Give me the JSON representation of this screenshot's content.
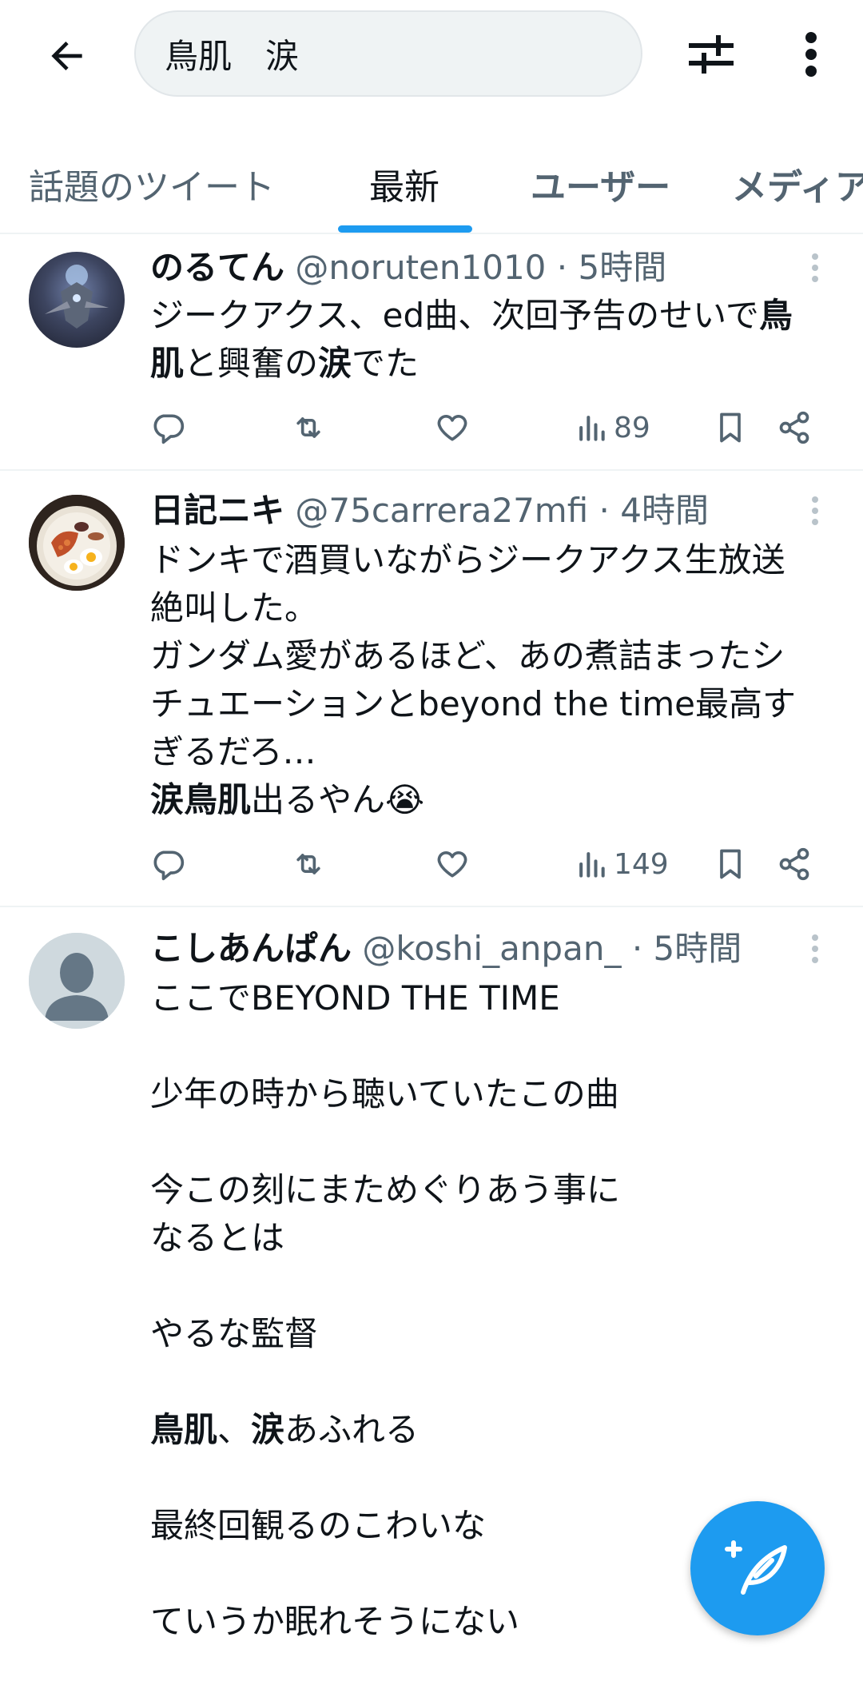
{
  "header": {
    "search_value": "鳥肌　涙",
    "back_icon": "arrow-left-icon",
    "filter_icon": "sliders-icon",
    "more_icon": "more-vertical-icon"
  },
  "tabs": [
    {
      "label": "話題のツイート"
    },
    {
      "label": "最新"
    },
    {
      "label": "ユーザー"
    },
    {
      "label": "メディア"
    }
  ],
  "tweets": [
    {
      "name": "のるてん",
      "handle": "@noruten1010",
      "sep": "·",
      "time": "5時間",
      "body": [
        [
          {
            "t": "ジークアクス、ed曲、次回予告のせいで"
          },
          {
            "t": "鳥",
            "b": true
          }
        ],
        [
          {
            "t": "肌",
            "b": true
          },
          {
            "t": "と興奮の"
          },
          {
            "t": "涙",
            "b": true
          },
          {
            "t": "でた"
          }
        ]
      ],
      "views": "89"
    },
    {
      "name": "日記ニキ",
      "handle": "@75carrera27mfi",
      "sep": "·",
      "time": "4時間",
      "body": [
        [
          {
            "t": "ドンキで酒買いながらジークアクス生放送"
          }
        ],
        [
          {
            "t": "絶叫した。"
          }
        ],
        [
          {
            "t": "ガンダム愛があるほど、あの煮詰まったシ"
          }
        ],
        [
          {
            "t": "チュエーションとbeyond the time最高す"
          }
        ],
        [
          {
            "t": "ぎるだろ…"
          }
        ],
        [
          {
            "t": "涙鳥肌",
            "b": true
          },
          {
            "t": "出るやん😭"
          }
        ]
      ],
      "views": "149"
    },
    {
      "name": "こしあんぱん",
      "handle": "@koshi_anpan_",
      "sep": "·",
      "time": "5時間",
      "body": [
        [
          {
            "t": "ここでBEYOND THE TIME"
          }
        ],
        [
          {
            "t": ""
          }
        ],
        [
          {
            "t": "少年の時から聴いていたこの曲"
          }
        ],
        [
          {
            "t": ""
          }
        ],
        [
          {
            "t": "今この刻にまためぐりあう事に"
          }
        ],
        [
          {
            "t": "なるとは"
          }
        ],
        [
          {
            "t": ""
          }
        ],
        [
          {
            "t": "やるな監督"
          }
        ],
        [
          {
            "t": ""
          }
        ],
        [
          {
            "t": "鳥肌",
            "b": true
          },
          {
            "t": "、"
          },
          {
            "t": "涙",
            "b": true
          },
          {
            "t": "あふれる"
          }
        ],
        [
          {
            "t": ""
          }
        ],
        [
          {
            "t": "最終回観るのこわいな"
          }
        ],
        [
          {
            "t": ""
          }
        ],
        [
          {
            "t": "ていうか眠れそうにない"
          }
        ]
      ],
      "views": ""
    }
  ],
  "action_icons": [
    "reply-icon",
    "retweet-icon",
    "like-icon",
    "views-icon",
    "bookmark-icon",
    "share-icon"
  ],
  "compose_icon": "compose-feather-icon",
  "colors": {
    "accent": "#1d9bf0",
    "text": "#0f1419",
    "muted": "#536471"
  }
}
